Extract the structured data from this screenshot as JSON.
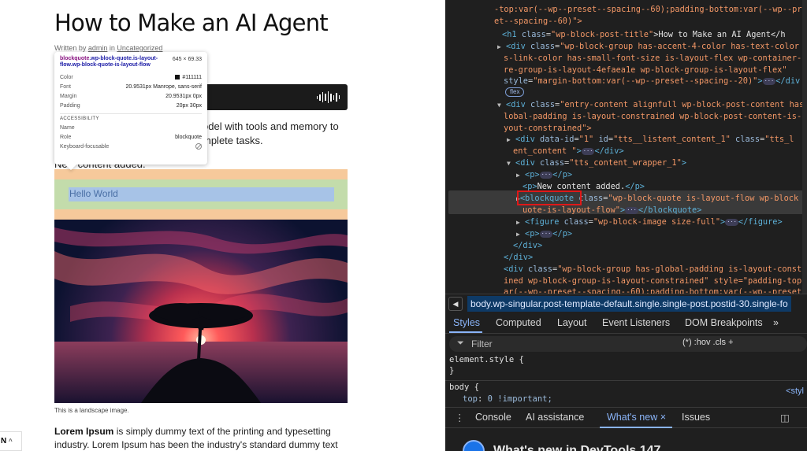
{
  "post": {
    "title": "How to Make an AI Agent",
    "byline_prefix": "Written by ",
    "author": "admin",
    "byline_mid": " in ",
    "category": "Uncategorized",
    "para_line1": "odel with tools and memory to",
    "para_line2": "mplete tasks.",
    "new_content_partial": "New content added.",
    "blockquote_text": "Hello World",
    "image_caption": "This is a landscape image.",
    "lorem_bold": "Lorem Ipsum",
    "lorem_rest": " is simply dummy text of the printing and typesetting industry. Lorem Ipsum has been the industry's standard dummy text",
    "lang_code": "N",
    "lang_chevron": "^"
  },
  "inspector": {
    "sel_tag": "blockquote",
    "sel_classes": ".wp-block-quote.is-layout-flow.wp-block-quote-is-layout-flow",
    "dims": "645 × 69.33",
    "color_label": "Color",
    "color_value": "#111111",
    "font_label": "Font",
    "font_value": "20.9531px Manrope, sans-serif",
    "margin_label": "Margin",
    "margin_value": "20.9531px 0px",
    "padding_label": "Padding",
    "padding_value": "20px 30px",
    "accessibility_heading": "ACCESSIBILITY",
    "name_label": "Name",
    "name_value": "",
    "role_label": "Role",
    "role_value": "blockquote",
    "keyboard_label": "Keyboard-focusable"
  },
  "devtools": {
    "lines": {
      "l1": "-top:var(--wp--preset--spacing--60);padding-bottom:var(--wp--pr",
      "l2": "et--spacing--60)\">",
      "l3_tag": "<h1 ",
      "l3_attr": "class",
      "l3_val": "\"wp-block-post-title\"",
      "l3_text": ">How to Make an AI Agent</h",
      "l4_tag": "<div ",
      "l4_attr": "class",
      "l4_val": "\"wp-block-group has-accent-4-color has-text-color",
      "l5": "s-link-color has-small-font-size is-layout-flex wp-container-",
      "l6": "re-group-is-layout-4efaea1e wp-block-group-is-layout-flex\"",
      "l7_attr": "style",
      "l7_val": "\"margin-bottom:var(--wp--preset--spacing--20)\"",
      "l7_close": "</div",
      "flex_badge": "flex",
      "l8_tag": "<div ",
      "l8_attr": "class",
      "l8_val": "\"entry-content alignfull wp-block-post-content has",
      "l9": "lobal-padding is-layout-constrained wp-block-post-content-is-",
      "l10": "yout-constrained\">",
      "l11_tag": "<div ",
      "l11_attr": "data-id",
      "l11_val": "\"1\"",
      "l11_attr2": " id",
      "l11_val2": "\"tts__listent_content_1\"",
      "l11_attr3": " class",
      "l11_val3": "\"tts_l",
      "l12_val": "ent_content \"",
      "l12_close": "</div>",
      "l13_tag": "<div ",
      "l13_attr": "class",
      "l13_val": "\"tts_content_wrapper_1\"",
      "l14_tag": "<p>",
      "l14_close": "</p>",
      "l15_text": "New content added.",
      "l16_tag": "<blockquote",
      "l16_attr": " class",
      "l16_val": "\"wp-block-quote is-layout-flow wp-block",
      "l17_val": "uote-is-layout-flow\"",
      "l17_close": "</blockquote>",
      "l18_tag": "<figure ",
      "l18_attr": "class",
      "l18_val": "\"wp-block-image size-full\"",
      "l18_close": "</figure>",
      "l19_tag": "<p>",
      "l19_close": "</p>",
      "l20": "</div>",
      "l21": "</div>",
      "l22_tag": "<div ",
      "l22_attr": "class",
      "l22_val": "\"wp-block-group has-global-padding is-layout-const",
      "l23": "ined wp-block-group-is-layout-constrained\" style=\"padding-top",
      "l24": "ar(--wp--preset--spacing--60);padding-bottom:var(--wp--preset"
    },
    "ellipsis": "···",
    "breadcrumb": "body.wp-singular.post-template-default.single.single-post.postid-30.single-fo",
    "breadcrumb_btn": "◀",
    "tabs": [
      "Styles",
      "Computed",
      "Layout",
      "Event Listeners",
      "DOM Breakpoints",
      "»"
    ],
    "filter_placeholder": "Filter",
    "filter_tools": "(*)  :hov  .cls  +",
    "styles": {
      "element_style": "element.style {",
      "close": "}",
      "body_sel": "body {",
      "prop": "top",
      "val": "0 !important;",
      "link": "<styl"
    },
    "drawer_tabs": [
      "Console",
      "AI assistance",
      "What's new ×",
      "Issues"
    ],
    "whatsnew_title": "What's new in DevTools 147"
  },
  "colors": {
    "devtools_bg": "#1f1f1f",
    "accent_blue": "#8ab4f8",
    "highlight_red": "#e01818",
    "margin_overlay": "#f6c99b",
    "padding_overlay": "#c3dcab",
    "content_overlay": "#a7c3e7"
  }
}
